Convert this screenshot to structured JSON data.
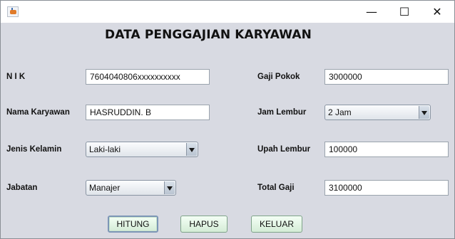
{
  "window": {
    "icon": "java-cup-icon",
    "controls": {
      "minimize": "—",
      "maximize": "☐",
      "close": "✕"
    }
  },
  "heading": "DATA PENGGAJIAN KARYAWAN",
  "form": {
    "nik": {
      "label": "N I K",
      "value": "7604040806xxxxxxxxxx"
    },
    "nama": {
      "label": "Nama Karyawan",
      "value": "HASRUDDIN. B"
    },
    "jenis_kelamin": {
      "label": "Jenis Kelamin",
      "selected": "Laki-laki"
    },
    "jabatan": {
      "label": "Jabatan",
      "selected": "Manajer"
    },
    "gaji_pokok": {
      "label": "Gaji Pokok",
      "value": "3000000"
    },
    "jam_lembur": {
      "label": "Jam Lembur",
      "selected": "2 Jam"
    },
    "upah_lembur": {
      "label": "Upah Lembur",
      "value": "100000"
    },
    "total_gaji": {
      "label": "Total Gaji",
      "value": "3100000"
    }
  },
  "buttons": {
    "hitung": "HITUNG",
    "hapus": "HAPUS",
    "keluar": "KELUAR"
  },
  "colors": {
    "panel": "#d8dae2",
    "button": "#dff2e2",
    "focus_border": "#7c96b6"
  }
}
